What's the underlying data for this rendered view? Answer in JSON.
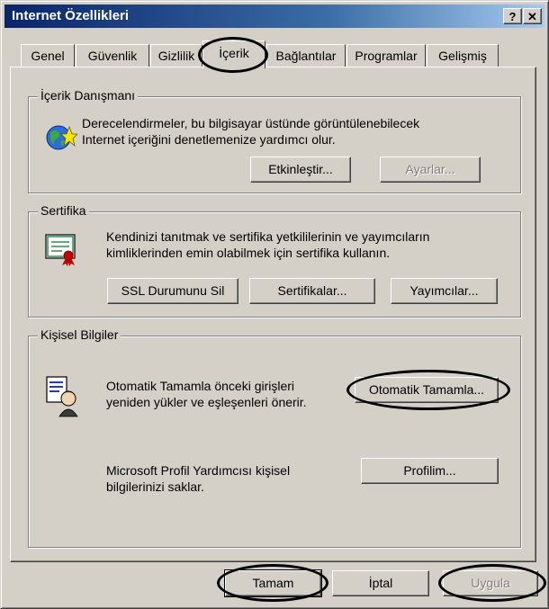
{
  "window": {
    "title": "Internet Özellikleri",
    "help_btn": "?",
    "close_btn": "✕"
  },
  "tabs": [
    "Genel",
    "Güvenlik",
    "Gizlilik",
    "İçerik",
    "Bağlantılar",
    "Programlar",
    "Gelişmiş"
  ],
  "content_advisor": {
    "legend": "İçerik Danışmanı",
    "desc_line1": "Derecelendirmeler, bu bilgisayar üstünde görüntülenebilecek",
    "desc_line2": "Internet içeriğini denetlemenize yardımcı olur.",
    "enable_button": "Etkinleştir...",
    "settings_button": "Ayarlar..."
  },
  "certificates": {
    "legend": "Sertifika",
    "desc_line1": "Kendinizi tanıtmak ve sertifika yetkililerinin ve yayımcıların",
    "desc_line2": "kimliklerinden emin olabilmek için sertifika kullanın.",
    "ssl_button": "SSL Durumunu Sil",
    "certs_button": "Sertifikalar...",
    "publishers_button": "Yayımcılar..."
  },
  "personal_info": {
    "legend": "Kişisel Bilgiler",
    "autocomplete_line1": "Otomatik Tamamla önceki girişleri",
    "autocomplete_line2": "yeniden yükler ve eşleşenleri önerir.",
    "autocomplete_button": "Otomatik Tamamla...",
    "profile_line1": "Microsoft Profil Yardımcısı kişisel",
    "profile_line2": "bilgilerinizi saklar.",
    "profile_button": "Profilim..."
  },
  "footer": {
    "ok_button": "Tamam",
    "cancel_button": "İptal",
    "apply_button": "Uygula"
  }
}
